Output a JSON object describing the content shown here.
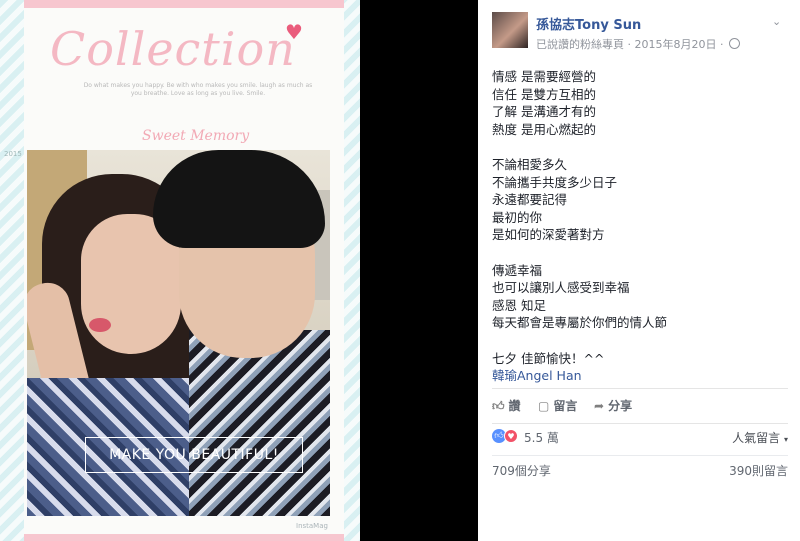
{
  "photo": {
    "collection_title": "Collection",
    "tagline": "Do what makes you happy. Be with who makes you smile. laugh as much as you breathe. Love as long as you live. Smile.",
    "sweet_memory": "Sweet Memory",
    "year": "2015",
    "make_beautiful": "MAKE YOU BEAUTIFUL!",
    "instamag": "InstaMag"
  },
  "post": {
    "author": "孫協志Tony Sun",
    "meta_text": "已說讚的粉絲專頁 · 2015年8月20日 ·",
    "lines": [
      "情感 是需要經營的",
      "信任 是雙方互相的",
      "了解 是溝通才有的",
      "熱度 是用心燃起的",
      "",
      "不論相愛多久",
      "不論攜手共度多少日子",
      "永遠都要記得",
      "最初的你",
      "是如何的深愛著對方",
      "",
      "傳遞幸福",
      "也可以讓別人感受到幸福",
      "感恩 知足",
      "每天都會是專屬於你們的情人節",
      "",
      "七夕 佳節愉快！^^"
    ],
    "tag": "韓瑜Angel Han",
    "actions": {
      "like": "讚",
      "comment": "留言",
      "share": "分享"
    },
    "reaction_count": "5.5 萬",
    "top_comments": "人氣留言",
    "shares": "709個分享",
    "comments": "390則留言"
  },
  "colors": {
    "link": "#365899",
    "like_reaction": "#5890ff",
    "love_reaction": "#f25268"
  },
  "icons": [
    "chevron-down-icon",
    "globe-icon",
    "thumbs-up-icon",
    "comment-icon",
    "share-icon",
    "like-reaction-icon",
    "love-reaction-icon",
    "heart-icon"
  ]
}
